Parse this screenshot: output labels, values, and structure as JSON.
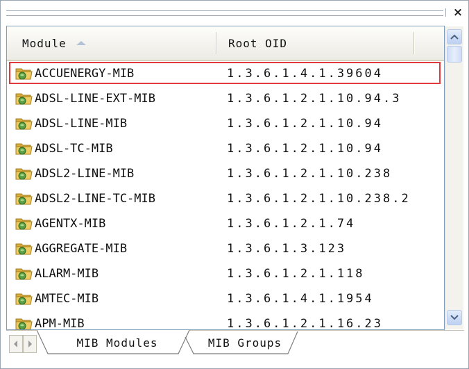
{
  "window": {
    "close_glyph": "×"
  },
  "columns": {
    "module": "Module",
    "root_oid": "Root OID"
  },
  "rows": [
    {
      "module": "ACCUENERGY-MIB",
      "oid": "1.3.6.1.4.1.39604",
      "highlighted": true
    },
    {
      "module": "ADSL-LINE-EXT-MIB",
      "oid": "1.3.6.1.2.1.10.94.3"
    },
    {
      "module": "ADSL-LINE-MIB",
      "oid": "1.3.6.1.2.1.10.94"
    },
    {
      "module": "ADSL-TC-MIB",
      "oid": "1.3.6.1.2.1.10.94"
    },
    {
      "module": "ADSL2-LINE-MIB",
      "oid": "1.3.6.1.2.1.10.238"
    },
    {
      "module": "ADSL2-LINE-TC-MIB",
      "oid": "1.3.6.1.2.1.10.238.2"
    },
    {
      "module": "AGENTX-MIB",
      "oid": "1.3.6.1.2.1.74"
    },
    {
      "module": "AGGREGATE-MIB",
      "oid": "1.3.6.1.3.123"
    },
    {
      "module": "ALARM-MIB",
      "oid": "1.3.6.1.2.1.118"
    },
    {
      "module": "AMTEC-MIB",
      "oid": "1.3.6.1.4.1.1954"
    },
    {
      "module": "APM-MIB",
      "oid": "1.3.6.1.2.1.16.23"
    }
  ],
  "tabs": {
    "mib_modules": "MIB Modules",
    "mib_groups": "MIB Groups"
  },
  "icons": {
    "row_icon": "folder-icon",
    "sort": "sort-ascending-icon"
  },
  "colors": {
    "highlight_border": "#e0393e",
    "folder": "#e9c45a",
    "folder_badge": "#4d8f3a"
  }
}
